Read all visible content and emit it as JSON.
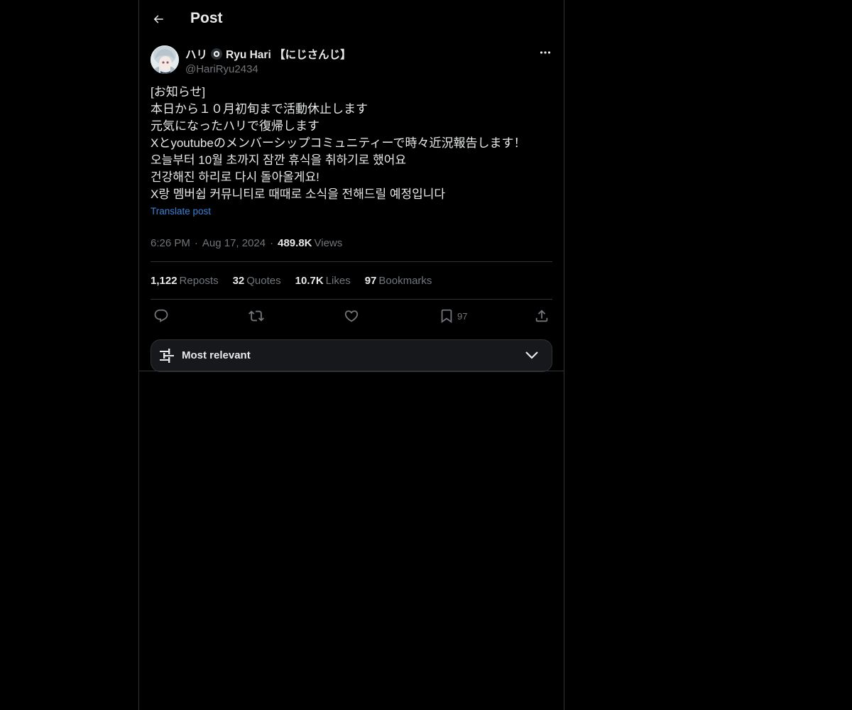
{
  "header": {
    "title": "Post",
    "back_icon": "arrow-left-icon"
  },
  "author": {
    "display_name_prefix": "ハリ",
    "badge_icon": "circle-badge-icon",
    "display_name_suffix": "Ryu Hari 【にじさんじ】",
    "handle": "@HariRyu2434",
    "more_icon": "ellipsis-icon"
  },
  "post": {
    "lines": [
      "[お知らせ]",
      "本日から１０月初旬まで活動休止します",
      "元気になったハリで復帰します",
      "Xとyoutubeのメンバーシップコミュニティーで時々近況報告します！",
      "오늘부터 10월 초까지 잠깐 휴식을 취하기로 했어요",
      "건강해진 하리로 다시 돌아올게요!",
      "X랑 멤버쉽 커뮤니티로 때때로 소식을 전해드릴 예정입니다"
    ],
    "translate_label": "Translate post",
    "time": "6:26 PM",
    "date": "Aug 17, 2024",
    "views_count": "489.8K",
    "views_label": "Views",
    "separator": "·"
  },
  "stats": {
    "reposts_count": "1,122",
    "reposts_label": "Reposts",
    "quotes_count": "32",
    "quotes_label": "Quotes",
    "likes_count": "10.7K",
    "likes_label": "Likes",
    "bookmarks_count": "97",
    "bookmarks_label": "Bookmarks"
  },
  "actions": {
    "reply_icon": "reply-icon",
    "repost_icon": "repost-icon",
    "like_icon": "heart-icon",
    "bookmark_icon": "bookmark-icon",
    "bookmark_count": "97",
    "share_icon": "share-icon"
  },
  "sort": {
    "label": "Most relevant",
    "icon": "sliders-icon",
    "chevron": "chevron-down-icon"
  },
  "colors": {
    "background": "#000000",
    "text": "#e7e9ea",
    "muted": "#71767b",
    "link": "#3b82d6",
    "border": "#2f3336"
  }
}
